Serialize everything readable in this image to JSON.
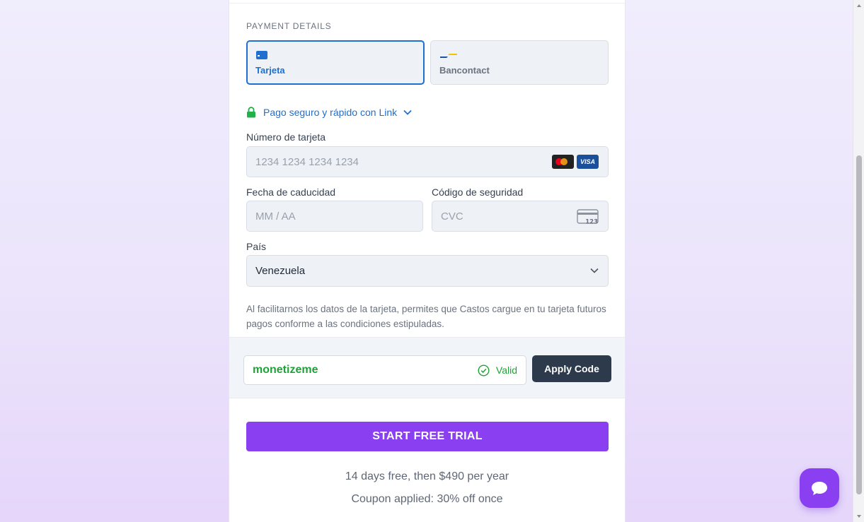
{
  "payment": {
    "section_label": "PAYMENT DETAILS",
    "tabs": [
      {
        "label": "Tarjeta",
        "icon": "credit-card-icon",
        "selected": true
      },
      {
        "label": "Bancontact",
        "icon": "bancontact-icon",
        "selected": false
      }
    ],
    "link_text": "Pago seguro y rápido con Link",
    "card_number": {
      "label": "Número de tarjeta",
      "placeholder": "1234 1234 1234 1234",
      "brands": [
        "mastercard",
        "VISA"
      ]
    },
    "expiry": {
      "label": "Fecha de caducidad",
      "placeholder": "MM / AA"
    },
    "cvc": {
      "label": "Código de seguridad",
      "placeholder": "CVC",
      "icon_text": "123"
    },
    "country": {
      "label": "País",
      "value": "Venezuela"
    },
    "disclaimer": "Al facilitarnos los datos de la tarjeta, permites que Castos cargue en tu tarjeta futuros pagos conforme a las condiciones estipuladas."
  },
  "coupon": {
    "code": "monetizeme",
    "status": "Valid",
    "apply_label": "Apply Code"
  },
  "cta": {
    "label": "START FREE TRIAL"
  },
  "pricing": {
    "line1": "14 days free, then $490 per year",
    "line2": "Coupon applied: 30% off once"
  },
  "colors": {
    "accent": "#8a3ff0",
    "link_blue": "#1e6fd0",
    "valid_green": "#22a03a",
    "apply_button": "#2d3a4c"
  }
}
